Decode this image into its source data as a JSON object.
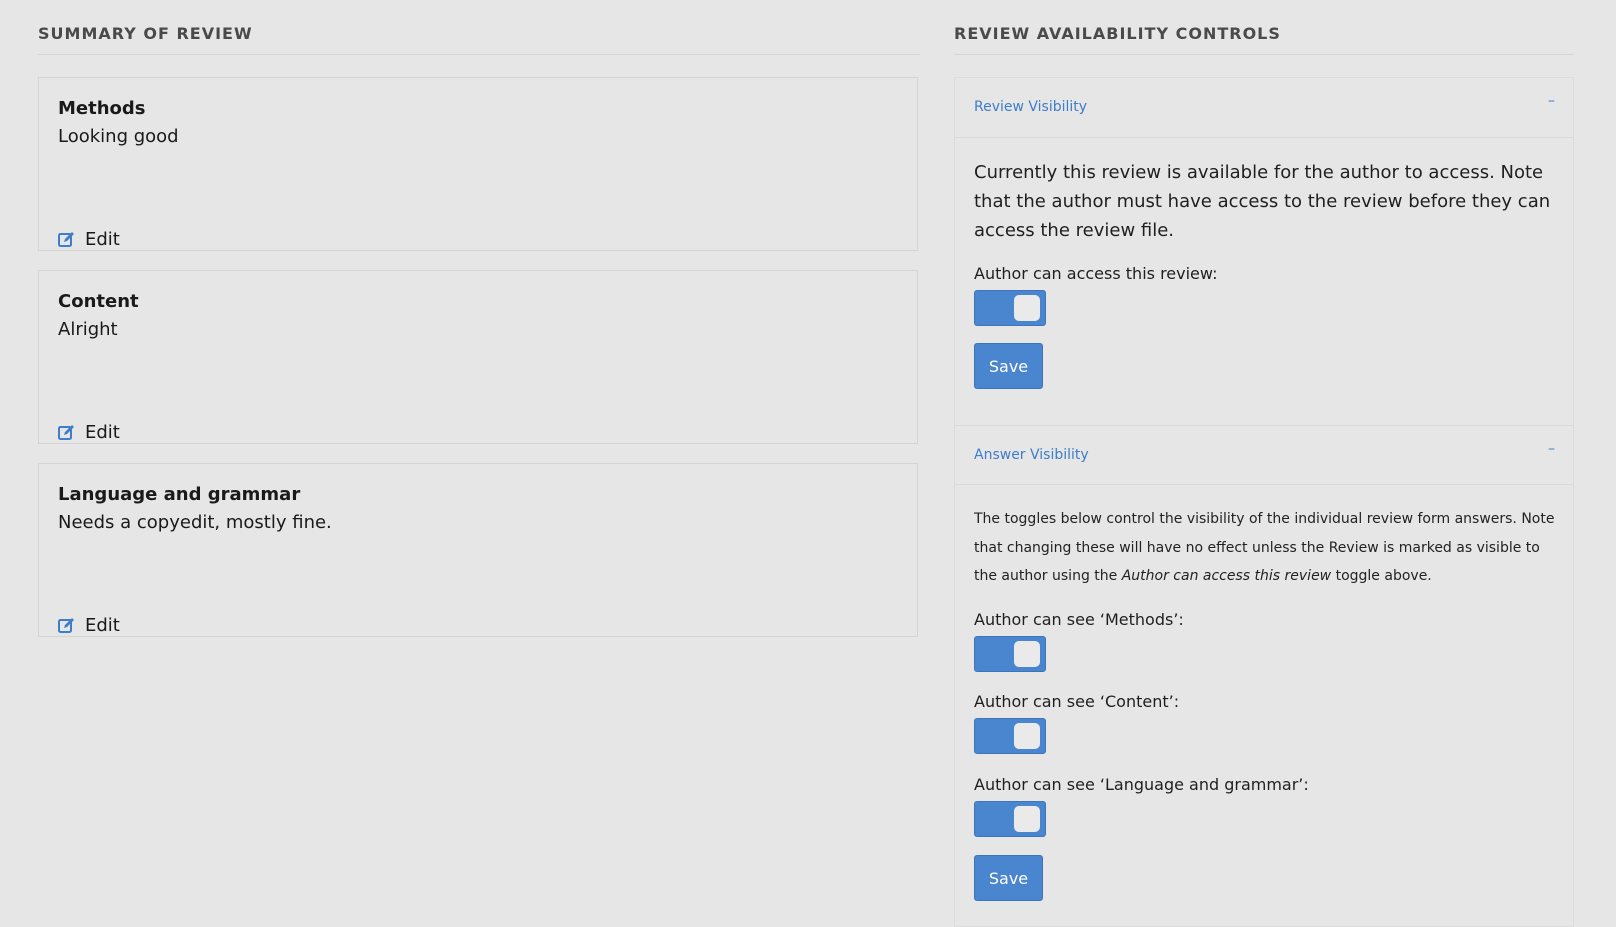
{
  "summary": {
    "heading": "SUMMARY OF REVIEW",
    "cards": [
      {
        "title": "Methods",
        "text": "Looking good",
        "edit_label": "Edit"
      },
      {
        "title": "Content",
        "text": "Alright",
        "edit_label": "Edit"
      },
      {
        "title": "Language and grammar",
        "text": "Needs a copyedit, mostly fine.",
        "edit_label": "Edit"
      }
    ]
  },
  "controls": {
    "heading": "REVIEW AVAILABILITY CONTROLS",
    "review_visibility": {
      "title": "Review Visibility",
      "collapse_symbol": "–",
      "description": "Currently this review is available for the author to access. Note that the author must have access to the review before they can access the review file.",
      "toggle_label": "Author can access this review:",
      "toggle_on": true,
      "save_label": "Save"
    },
    "answer_visibility": {
      "title": "Answer Visibility",
      "collapse_symbol": "–",
      "description_before": "The toggles below control the visibility of the individual review form answers. Note that changing these will have no effect unless the Review is marked as visible to the author using the ",
      "description_emphasis": "Author can access this review",
      "description_after": " toggle above.",
      "toggles": [
        {
          "label": "Author can see ‘Methods’:",
          "on": true
        },
        {
          "label": "Author can see ‘Content’:",
          "on": true
        },
        {
          "label": "Author can see ‘Language and grammar’:",
          "on": true
        }
      ],
      "save_label": "Save"
    }
  },
  "colors": {
    "accent": "#4a86d0",
    "link": "#3e7dc9",
    "background": "#e6e6e6"
  }
}
